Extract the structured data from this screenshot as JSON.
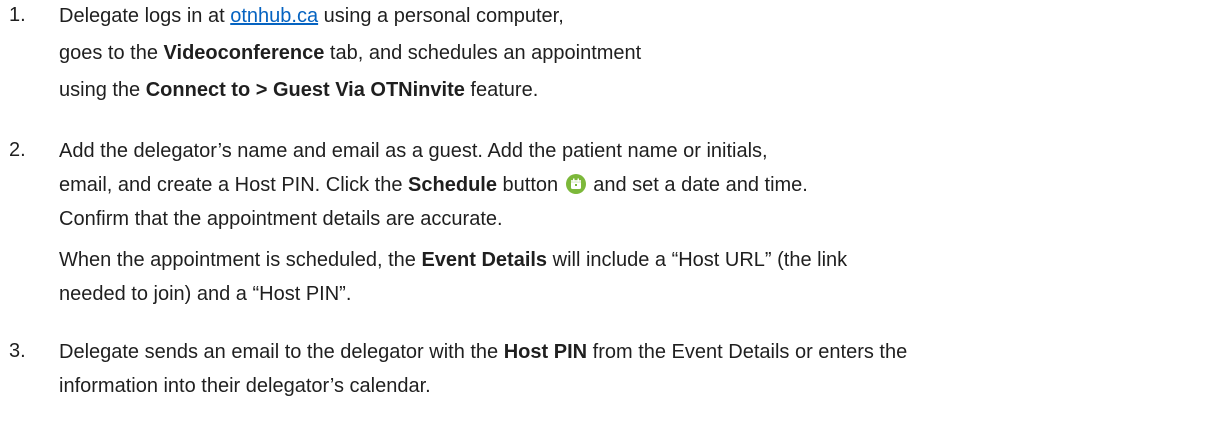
{
  "steps": [
    {
      "number": "1.",
      "lines": [
        {
          "pre": "Delegate logs in at ",
          "link": "otnhub.ca",
          "post": " using a personal computer,"
        },
        {
          "pre": "goes to the ",
          "bold": "Videoconference",
          "post": " tab, and schedules an appointment"
        },
        {
          "pre": "using the ",
          "bold": "Connect to > Guest Via OTNinvite",
          "post": " feature."
        }
      ]
    },
    {
      "number": "2.",
      "lines": [
        {
          "text": "Add the delegator’s name and email as a guest. Add the patient name or initials,"
        },
        {
          "pre": "email, and create a Host PIN. Click the ",
          "bold": "Schedule",
          "mid": " button",
          "post": " and set a date and time."
        },
        {
          "text": "Confirm that the appointment details are accurate."
        },
        {
          "pre": "When the appointment is scheduled, the ",
          "bold": "Event Details",
          "post": " will include a “Host URL” (the link"
        },
        {
          "text": "needed to join) and a “Host PIN”."
        }
      ],
      "icon": "calendar-icon",
      "icon_color": "#7cb83a"
    },
    {
      "number": "3.",
      "lines": [
        {
          "pre": "Delegate sends an email to the delegator with the ",
          "bold": "Host PIN",
          "post": " from the Event Details or enters the"
        },
        {
          "text": "information into their delegator’s calendar."
        }
      ]
    }
  ],
  "colors": {
    "link": "#0563c1",
    "text": "#1f1f1f"
  }
}
